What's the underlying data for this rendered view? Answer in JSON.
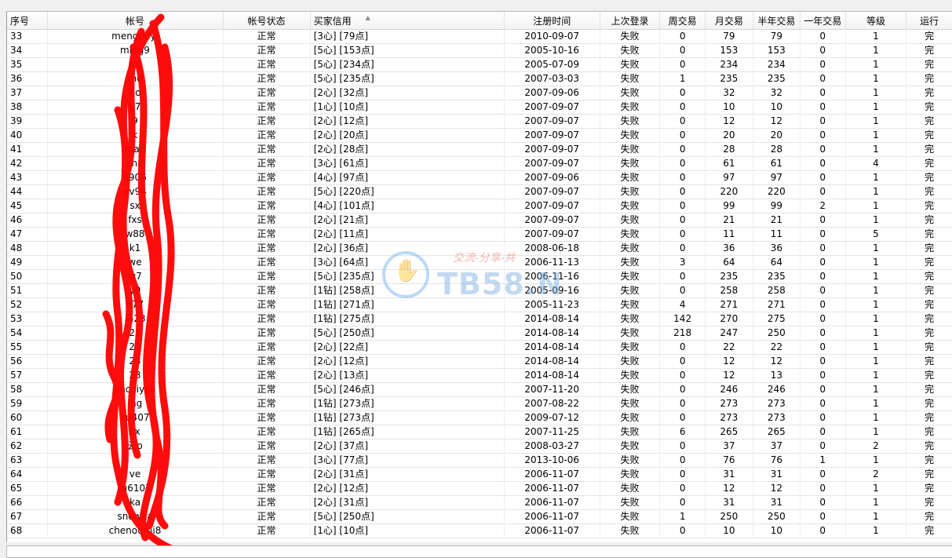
{
  "columns": [
    {
      "key": "id",
      "label": "序号",
      "width": 52,
      "align": "left"
    },
    {
      "key": "account",
      "label": "帐号",
      "width": 232,
      "align": "center"
    },
    {
      "key": "status",
      "label": "帐号状态",
      "width": 114,
      "align": "center"
    },
    {
      "key": "credit",
      "label": "买家信用",
      "width": 256,
      "align": "left"
    },
    {
      "key": "register",
      "label": "注册时间",
      "width": 124,
      "align": "center"
    },
    {
      "key": "last_login",
      "label": "上次登录",
      "width": 78,
      "align": "center"
    },
    {
      "key": "week",
      "label": "周交易",
      "width": 58,
      "align": "center"
    },
    {
      "key": "month",
      "label": "月交易",
      "width": 62,
      "align": "center"
    },
    {
      "key": "half_year",
      "label": "半年交易",
      "width": 60,
      "align": "center"
    },
    {
      "key": "year",
      "label": "一年交易",
      "width": 58,
      "align": "center"
    },
    {
      "key": "level",
      "label": "等级",
      "width": 80,
      "align": "center"
    },
    {
      "key": "run",
      "label": "运行",
      "width": 60,
      "align": "center"
    }
  ],
  "sort_indicator": "▲",
  "rows": [
    [
      "33",
      "mengdeyi",
      "正常",
      "[3心] [79点]",
      "2010-09-07",
      "失败",
      "0",
      "79",
      "79",
      "0",
      "1",
      "完"
    ],
    [
      "34",
      "ming9",
      "正常",
      "[5心] [153点]",
      "2005-10-16",
      "失败",
      "0",
      "153",
      "153",
      "0",
      "1",
      "完"
    ],
    [
      "35",
      "mj",
      "正常",
      "[5心] [234点]",
      "2005-07-09",
      "失败",
      "0",
      "234",
      "234",
      "0",
      "1",
      "完"
    ],
    [
      "36",
      "mo",
      "正常",
      "[5心] [235点]",
      "2007-03-03",
      "失败",
      "1",
      "235",
      "235",
      "0",
      "1",
      "完"
    ],
    [
      "37",
      "qo",
      "正常",
      "[2心] [32点]",
      "2007-09-06",
      "失败",
      "0",
      "32",
      "32",
      "0",
      "1",
      "完"
    ],
    [
      "38",
      "y7",
      "正常",
      "[1心] [10点]",
      "2007-09-07",
      "失败",
      "0",
      "10",
      "10",
      "0",
      "1",
      "完"
    ],
    [
      "39",
      "9",
      "正常",
      "[2心] [12点]",
      "2007-09-07",
      "失败",
      "0",
      "12",
      "12",
      "0",
      "1",
      "完"
    ],
    [
      "40",
      "k",
      "正常",
      "[2心] [20点]",
      "2007-09-07",
      "失败",
      "0",
      "20",
      "20",
      "0",
      "1",
      "完"
    ],
    [
      "41",
      "mag",
      "正常",
      "[2心] [28点]",
      "2007-09-07",
      "失败",
      "0",
      "28",
      "28",
      "0",
      "1",
      "完"
    ],
    [
      "42",
      "zh8",
      "正常",
      "[3心] [61点]",
      "2007-09-07",
      "失败",
      "0",
      "61",
      "61",
      "0",
      "4",
      "完"
    ],
    [
      "43",
      "li906",
      "正常",
      "[4心] [97点]",
      "2007-09-06",
      "失败",
      "0",
      "97",
      "97",
      "0",
      "1",
      "完"
    ],
    [
      "44",
      "ev94",
      "正常",
      "[5心] [220点]",
      "2007-09-07",
      "失败",
      "0",
      "220",
      "220",
      "0",
      "1",
      "完"
    ],
    [
      "45",
      "sx",
      "正常",
      "[4心] [101点]",
      "2007-09-07",
      "失败",
      "0",
      "99",
      "99",
      "2",
      "1",
      "完"
    ],
    [
      "46",
      "fxs",
      "正常",
      "[2心] [21点]",
      "2007-09-07",
      "失败",
      "0",
      "21",
      "21",
      "0",
      "1",
      "完"
    ],
    [
      "47",
      "w88",
      "正常",
      "[2心] [11点]",
      "2007-09-07",
      "失败",
      "0",
      "11",
      "11",
      "0",
      "5",
      "完"
    ],
    [
      "48",
      "k1",
      "正常",
      "[2心] [36点]",
      "2008-06-18",
      "失败",
      "0",
      "36",
      "36",
      "0",
      "1",
      "完"
    ],
    [
      "49",
      "we",
      "正常",
      "[3心] [64点]",
      "2006-11-13",
      "失败",
      "3",
      "64",
      "64",
      "0",
      "1",
      "完"
    ],
    [
      "50",
      "w7",
      "正常",
      "[5心] [235点]",
      "2006-11-16",
      "失败",
      "0",
      "235",
      "235",
      "0",
      "1",
      "完"
    ],
    [
      "51",
      "y0",
      "正常",
      "[1钻] [258点]",
      "2005-09-16",
      "失败",
      "0",
      "258",
      "258",
      "0",
      "1",
      "完"
    ],
    [
      "52",
      "o77",
      "正常",
      "[1钻] [271点]",
      "2005-11-23",
      "失败",
      "4",
      "271",
      "271",
      "0",
      "1",
      "完"
    ],
    [
      "53",
      "马23",
      "正常",
      "[1钻] [275点]",
      "2014-08-14",
      "失败",
      "142",
      "270",
      "275",
      "0",
      "1",
      "完"
    ],
    [
      "54",
      "23",
      "正常",
      "[5心] [250点]",
      "2014-08-14",
      "失败",
      "218",
      "247",
      "250",
      "0",
      "1",
      "完"
    ],
    [
      "55",
      "23",
      "正常",
      "[2心] [22点]",
      "2014-08-14",
      "失败",
      "0",
      "22",
      "22",
      "0",
      "1",
      "完"
    ],
    [
      "56",
      "23",
      "正常",
      "[2心] [12点]",
      "2014-08-14",
      "失败",
      "0",
      "12",
      "12",
      "0",
      "1",
      "完"
    ],
    [
      "57",
      "23",
      "正常",
      "[2心] [13点]",
      "2014-08-14",
      "失败",
      "0",
      "12",
      "13",
      "0",
      "1",
      "完"
    ],
    [
      "58",
      "jincaiyiui",
      "正常",
      "[5心] [246点]",
      "2007-11-20",
      "失败",
      "0",
      "246",
      "246",
      "0",
      "1",
      "完"
    ],
    [
      "59",
      "ing",
      "正常",
      "[1钻] [273点]",
      "2007-08-22",
      "失败",
      "0",
      "273",
      "273",
      "0",
      "1",
      "完"
    ],
    [
      "60",
      "ku407",
      "正常",
      "[1钻] [273点]",
      "2009-07-12",
      "失败",
      "0",
      "273",
      "273",
      "0",
      "1",
      "完"
    ],
    [
      "61",
      "zx",
      "正常",
      "[1钻] [265点]",
      "2007-11-25",
      "失败",
      "6",
      "265",
      "265",
      "0",
      "1",
      "完"
    ],
    [
      "62",
      "云o",
      "正常",
      "[2心] [37点]",
      "2008-03-27",
      "失败",
      "0",
      "37",
      "37",
      "0",
      "2",
      "完"
    ],
    [
      "63",
      "",
      "正常",
      "[3心] [77点]",
      "2013-10-06",
      "失败",
      "0",
      "76",
      "76",
      "1",
      "1",
      "完"
    ],
    [
      "64",
      "ve",
      "正常",
      "[2心] [31点]",
      "2006-11-07",
      "失败",
      "0",
      "31",
      "31",
      "0",
      "2",
      "完"
    ],
    [
      "65",
      "lu6107",
      "正常",
      "[2心] [12点]",
      "2006-11-07",
      "失败",
      "0",
      "12",
      "12",
      "0",
      "1",
      "完"
    ],
    [
      "66",
      "ka",
      "正常",
      "[2心] [31点]",
      "2006-11-07",
      "失败",
      "0",
      "31",
      "31",
      "0",
      "1",
      "完"
    ],
    [
      "67",
      "snowka",
      "正常",
      "[5心] [250点]",
      "2006-11-07",
      "失败",
      "1",
      "250",
      "250",
      "0",
      "1",
      "完"
    ],
    [
      "68",
      "chenoumi8",
      "正常",
      "[1心] [10点]",
      "2006-11-07",
      "失败",
      "0",
      "10",
      "10",
      "0",
      "1",
      "完"
    ]
  ],
  "watermark": {
    "brand": "TB58.N",
    "slogan": "交流-分享-共"
  },
  "colors": {
    "scribble": "#ff0000",
    "header_bg": "#f5f5f5",
    "grid_line": "#e4e4e4"
  },
  "icons": {
    "sort": "sort-ascending-icon",
    "watermark_logo": "hand-logo-icon"
  }
}
